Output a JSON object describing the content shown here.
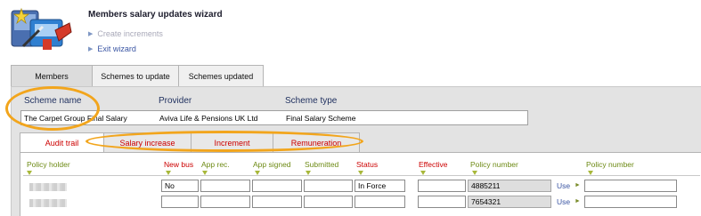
{
  "wizard": {
    "title": "Members salary updates wizard",
    "links": [
      {
        "label": "Create increments",
        "enabled": false
      },
      {
        "label": "Exit wizard",
        "enabled": true
      }
    ]
  },
  "top_tabs": [
    {
      "label": "Members",
      "active": true
    },
    {
      "label": "Schemes to update",
      "active": false
    },
    {
      "label": "Schemes updated",
      "active": false
    }
  ],
  "scheme": {
    "name_label": "Scheme name",
    "provider_label": "Provider",
    "type_label": "Scheme type",
    "name_value": "The Carpet Group Final Salary",
    "provider_value": "Aviva Life & Pensions UK Ltd",
    "type_value": "Final Salary Scheme"
  },
  "inner_tabs": [
    {
      "label": "Audit trail",
      "active": true
    },
    {
      "label": "Salary increase",
      "active": false
    },
    {
      "label": "Increment",
      "active": false
    },
    {
      "label": "Remuneration",
      "active": false
    }
  ],
  "grid": {
    "columns": {
      "policy_holder": "Policy holder",
      "new_bus": "New bus",
      "app_rec": "App rec.",
      "app_signed": "App signed",
      "submitted": "Submitted",
      "status": "Status",
      "effective": "Effective",
      "policy_number": "Policy number",
      "policy_number_2": "Policy number"
    },
    "use_label": "Use",
    "rows": [
      {
        "new_bus": "No",
        "status": "In Force",
        "policy_number": "4885211"
      },
      {
        "new_bus": "",
        "status": "",
        "policy_number": "7654321"
      }
    ]
  },
  "colors": {
    "highlight": "#f2a51c",
    "header_olive": "#6d8a14",
    "header_red": "#cc0000",
    "link_blue": "#3a55a3"
  }
}
